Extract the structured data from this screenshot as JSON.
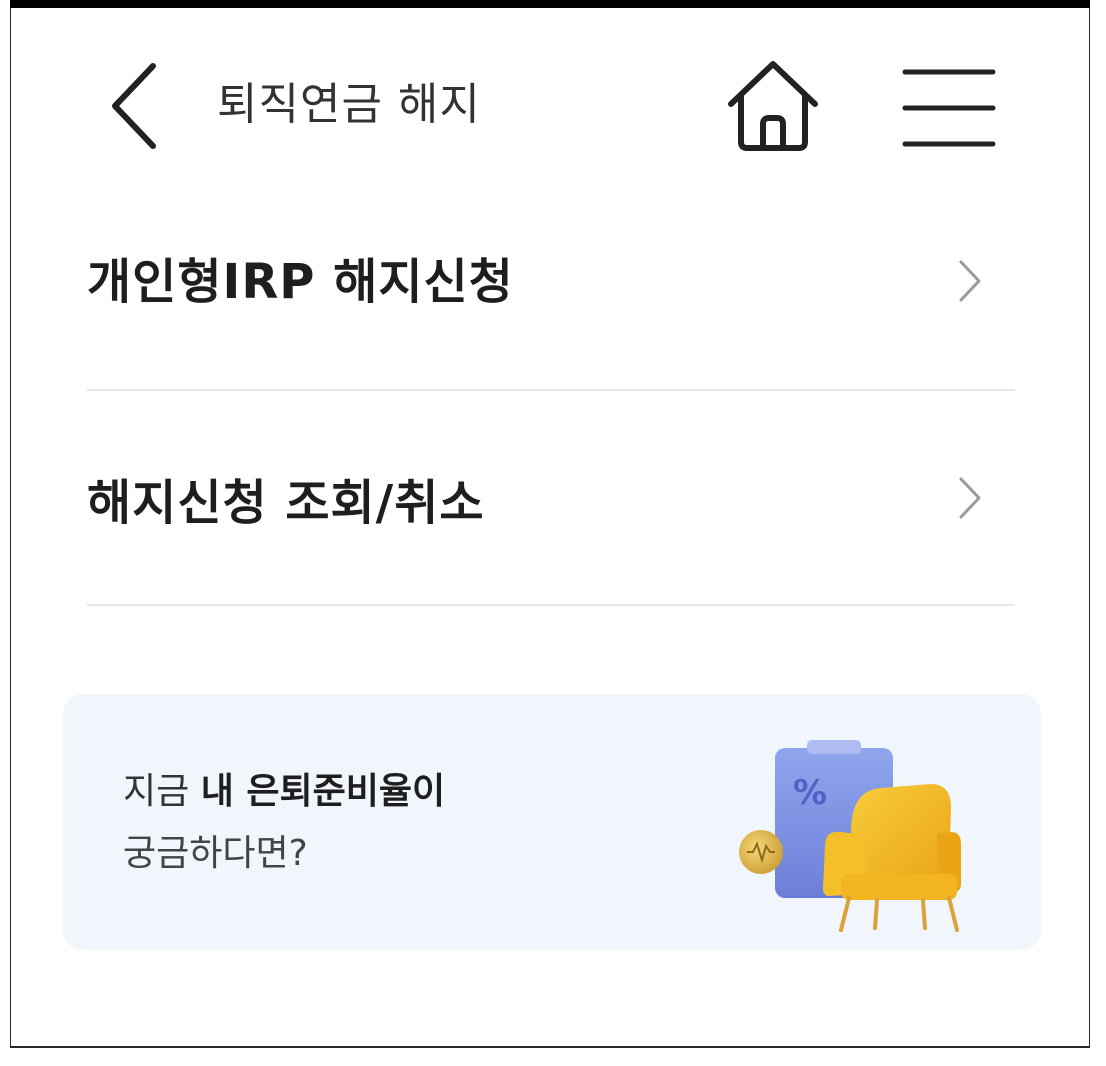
{
  "header": {
    "title": "퇴직연금 해지",
    "back_icon": "chevron-left-icon",
    "home_icon": "home-icon",
    "menu_icon": "hamburger-menu-icon"
  },
  "menu": {
    "items": [
      {
        "label": "개인형IRP 해지신청",
        "icon": "chevron-right-icon"
      },
      {
        "label": "해지신청 조회/취소",
        "icon": "chevron-right-icon"
      }
    ]
  },
  "banner": {
    "line1_prefix": "지금 ",
    "line1_bold": "내 은퇴준비율이",
    "line2": "궁금하다면?",
    "illustration": "percent-clipboard-armchair-coin-illustration",
    "illustration_symbol": "%",
    "colors": {
      "background": "#f0f6fc",
      "clipboard": "#7b8fe0",
      "chair": "#f2b824",
      "coin": "#e3b54a"
    }
  }
}
